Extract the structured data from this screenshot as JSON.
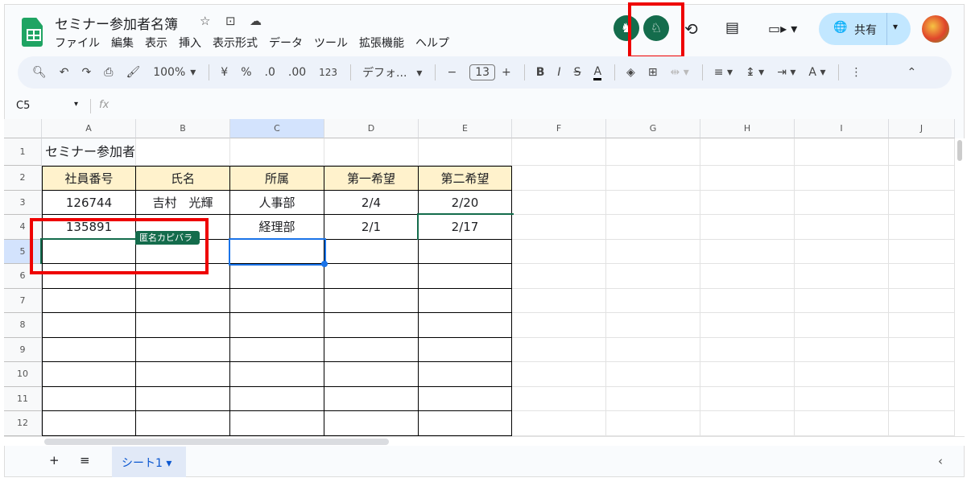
{
  "header": {
    "title": "セミナー参加者名簿",
    "menu": [
      "ファイル",
      "編集",
      "表示",
      "挿入",
      "表示形式",
      "データ",
      "ツール",
      "拡張機能",
      "ヘルプ"
    ],
    "share_label": "共有"
  },
  "toolbar": {
    "zoom": "100%",
    "currency": "¥",
    "percent": "%",
    "dec_dec": ".0",
    "dec_inc": ".00",
    "format_123": "123",
    "font": "デフォ...",
    "font_size": "13"
  },
  "formula_bar": {
    "cell_ref": "C5",
    "fx": "fx",
    "value": ""
  },
  "collaborator_tag": "匿名カピバラ",
  "sheet": {
    "columns": [
      "A",
      "B",
      "C",
      "D",
      "E",
      "F",
      "G",
      "H",
      "I",
      "J"
    ],
    "rows": [
      "1",
      "2",
      "3",
      "4",
      "5",
      "6",
      "7",
      "8",
      "9",
      "10",
      "11",
      "12"
    ],
    "selected_column": "C",
    "selected_row": "5",
    "cells": {
      "A1": "セミナー参加者",
      "A2": "社員番号",
      "B2": "氏名",
      "C2": "所属",
      "D2": "第一希望",
      "E2": "第二希望",
      "A3": "126744",
      "B3": "吉村　光輝",
      "C3": "人事部",
      "D3": "2/4",
      "E3": "2/20",
      "A4": "135891",
      "C4": "経理部",
      "D4": "2/1",
      "E4": "2/17"
    },
    "header_fill": "#fff2cc"
  },
  "tabs": {
    "sheet_name": "シート1"
  },
  "colors": {
    "accent": "#0b57d0",
    "collab": "#146c4c",
    "highlight": "#e00000"
  }
}
